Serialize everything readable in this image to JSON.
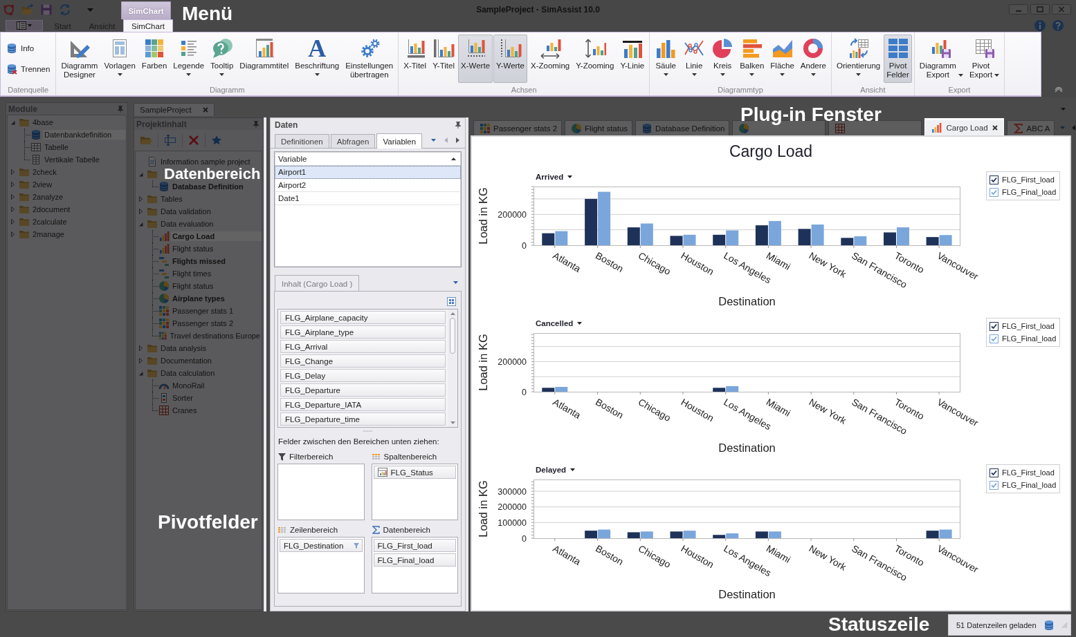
{
  "window": {
    "title": "SampleProject - SimAssist 10.0"
  },
  "context_tab": "SimChart",
  "ribbon_tabs": [
    {
      "label": "Start",
      "selected": false
    },
    {
      "label": "Ansicht",
      "selected": false
    },
    {
      "label": "SimChart",
      "selected": true
    }
  ],
  "ribbon": {
    "groups": [
      {
        "label": "Datenquelle",
        "buttons": [
          {
            "label": "Info",
            "kind": "small",
            "selected": false,
            "dropdown": false
          },
          {
            "label": "Trennen",
            "kind": "small",
            "selected": false,
            "dropdown": false
          }
        ]
      },
      {
        "label": "Diagramm",
        "buttons": [
          {
            "label": "Diagramm\nDesigner",
            "kind": "large",
            "selected": false,
            "dropdown": false
          },
          {
            "label": "Vorlagen",
            "kind": "large",
            "selected": false,
            "dropdown": true
          },
          {
            "label": "Farben",
            "kind": "large",
            "selected": false,
            "dropdown": false
          },
          {
            "label": "Legende",
            "kind": "large",
            "selected": false,
            "dropdown": true
          },
          {
            "label": "Tooltip",
            "kind": "large",
            "selected": false,
            "dropdown": true
          },
          {
            "label": "Diagrammtitel",
            "kind": "large",
            "selected": false,
            "dropdown": false
          },
          {
            "label": "Beschriftung",
            "kind": "large",
            "glyph": "A",
            "selected": false,
            "dropdown": true
          },
          {
            "label": "Einstellungen\nübertragen",
            "kind": "large",
            "selected": false,
            "dropdown": false
          }
        ]
      },
      {
        "label": "Achsen",
        "buttons": [
          {
            "label": "X-Titel",
            "kind": "large",
            "selected": false,
            "dropdown": false
          },
          {
            "label": "Y-Titel",
            "kind": "large",
            "selected": false,
            "dropdown": false
          },
          {
            "label": "X-Werte",
            "kind": "large",
            "selected": true,
            "dropdown": false
          },
          {
            "label": "Y-Werte",
            "kind": "large",
            "selected": true,
            "dropdown": false
          },
          {
            "label": "X-Zooming",
            "kind": "large",
            "selected": false,
            "dropdown": false
          },
          {
            "label": "Y-Zooming",
            "kind": "large",
            "selected": false,
            "dropdown": false
          },
          {
            "label": "Y-Linie",
            "kind": "large",
            "selected": false,
            "dropdown": false
          }
        ]
      },
      {
        "label": "Diagrammtyp",
        "buttons": [
          {
            "label": "Säule",
            "kind": "large",
            "selected": false,
            "dropdown": true
          },
          {
            "label": "Linie",
            "kind": "large",
            "selected": false,
            "dropdown": true
          },
          {
            "label": "Kreis",
            "kind": "large",
            "selected": false,
            "dropdown": true
          },
          {
            "label": "Balken",
            "kind": "large",
            "selected": false,
            "dropdown": true
          },
          {
            "label": "Fläche",
            "kind": "large",
            "selected": false,
            "dropdown": true
          },
          {
            "label": "Andere",
            "kind": "large",
            "selected": false,
            "dropdown": true
          }
        ]
      },
      {
        "label": "Ansicht",
        "buttons": [
          {
            "label": "Orientierung",
            "kind": "large",
            "selected": false,
            "dropdown": true
          },
          {
            "label": "Pivot\nFelder",
            "kind": "large",
            "selected": true,
            "dropdown": false
          }
        ]
      },
      {
        "label": "Export",
        "buttons": [
          {
            "label": "Diagramm\nExport",
            "kind": "large",
            "selected": false,
            "dropdown": true
          },
          {
            "label": "Pivot\nExport",
            "kind": "large",
            "selected": false,
            "dropdown": true
          }
        ]
      }
    ]
  },
  "modules": {
    "title": "Module",
    "tree": [
      {
        "label": "4base",
        "kind": "folder",
        "expanded": true,
        "selected": false,
        "children": [
          {
            "label": "Datenbankdefinition",
            "kind": "database",
            "selected": true
          },
          {
            "label": "Tabelle",
            "kind": "table",
            "selected": false
          },
          {
            "label": "Vertikale Tabelle",
            "kind": "vertical-table",
            "selected": false
          }
        ]
      },
      {
        "label": "2check",
        "kind": "folder",
        "expanded": false,
        "selected": false
      },
      {
        "label": "2view",
        "kind": "folder",
        "expanded": false,
        "selected": false
      },
      {
        "label": "2analyze",
        "kind": "folder",
        "expanded": false,
        "selected": false
      },
      {
        "label": "2document",
        "kind": "folder",
        "expanded": false,
        "selected": false
      },
      {
        "label": "2calculate",
        "kind": "folder",
        "expanded": false,
        "selected": false
      },
      {
        "label": "2manage",
        "kind": "folder",
        "expanded": false,
        "selected": false
      }
    ]
  },
  "project": {
    "tab": "SampleProject",
    "title": "Projektinhalt",
    "tree": [
      {
        "label": "Information sample project",
        "kind": "document",
        "selected": false,
        "bold": false
      },
      {
        "kind": "folder",
        "expanded": true,
        "children": [
          {
            "label": "Database Definition",
            "kind": "database",
            "selected": false,
            "bold": true
          }
        ]
      },
      {
        "label": "Tables",
        "kind": "folder",
        "expanded": false,
        "selected": false,
        "bold": false
      },
      {
        "label": "Data validation",
        "kind": "folder",
        "expanded": false,
        "selected": false,
        "bold": false
      },
      {
        "label": "Data evaluation",
        "kind": "folder",
        "expanded": true,
        "selected": false,
        "bold": false,
        "children": [
          {
            "label": "Cargo Load",
            "kind": "bar-chart",
            "selected": true,
            "bold": true
          },
          {
            "label": "Flight status",
            "kind": "bar-chart",
            "selected": false,
            "bold": false
          },
          {
            "label": "Flights missed",
            "kind": "gantt-chart",
            "selected": false,
            "bold": true
          },
          {
            "label": "Flight times",
            "kind": "gantt-chart",
            "selected": false,
            "bold": false
          },
          {
            "label": "Flight status",
            "kind": "pie-chart",
            "selected": false,
            "bold": false
          },
          {
            "label": "Airplane types",
            "kind": "pie-chart",
            "selected": false,
            "bold": true
          },
          {
            "label": "Passenger stats 1",
            "kind": "heatmap",
            "selected": false,
            "bold": false
          },
          {
            "label": "Passenger stats 2",
            "kind": "heatmap",
            "selected": false,
            "bold": false
          },
          {
            "label": "Travel destinations Europe",
            "kind": "heatmap",
            "selected": false,
            "bold": false
          }
        ]
      },
      {
        "label": "Data analysis",
        "kind": "folder",
        "expanded": false,
        "selected": false,
        "bold": false
      },
      {
        "label": "Documentation",
        "kind": "folder",
        "expanded": false,
        "selected": false,
        "bold": false
      },
      {
        "label": "Data calculation",
        "kind": "folder",
        "expanded": true,
        "selected": false,
        "bold": false,
        "children": [
          {
            "label": "MonoRail",
            "kind": "gauge",
            "selected": false,
            "bold": false
          },
          {
            "label": "Sorter",
            "kind": "sorter",
            "selected": false,
            "bold": false
          },
          {
            "label": "Cranes",
            "kind": "crane",
            "selected": false,
            "bold": false
          }
        ]
      }
    ]
  },
  "data_panel": {
    "title": "Daten",
    "tabs": [
      {
        "label": "Definitionen",
        "selected": false
      },
      {
        "label": "Abfragen",
        "selected": false
      },
      {
        "label": "Variablen",
        "selected": true
      }
    ],
    "variables": {
      "column": "Variable",
      "sort_ascending": true,
      "rows": [
        {
          "label": "Airport1",
          "selected": true
        },
        {
          "label": "Airport2",
          "selected": false
        },
        {
          "label": "Date1",
          "selected": false
        }
      ]
    },
    "content_tab": "Inhalt (Cargo Load )",
    "fields": [
      "FLG_Airplane_capacity",
      "FLG_Airplane_type",
      "FLG_Arrival",
      "FLG_Change",
      "FLG_Delay",
      "FLG_Departure",
      "FLG_Departure_IATA",
      "FLG_Departure_time"
    ],
    "hint": "Felder zwischen den Bereichen unten ziehen:",
    "areas": [
      {
        "label": "Filterbereich",
        "kind": "filter"
      },
      {
        "label": "Spaltenbereich",
        "kind": "columns",
        "fields": [
          {
            "label": "FLG_Status"
          }
        ]
      },
      {
        "label": "Zeilenbereich",
        "kind": "rows",
        "fields": [
          {
            "label": "FLG_Destination"
          }
        ]
      },
      {
        "label": "Datenbereich",
        "kind": "data",
        "fields": [
          {
            "label": "FLG_First_load"
          },
          {
            "label": "FLG_Final_load"
          }
        ]
      }
    ]
  },
  "plugin_tabs": [
    {
      "label": "Passenger stats 2",
      "kind": "heatmap",
      "selected": false
    },
    {
      "label": "Flight status",
      "kind": "pie-chart",
      "selected": false
    },
    {
      "label": "Database Definition",
      "kind": "database",
      "selected": false
    },
    {
      "kind": "pie-chart",
      "selected": false
    },
    {
      "kind": "crane",
      "selected": false
    },
    {
      "label": "Cargo Load",
      "kind": "bar-chart",
      "selected": true
    },
    {
      "label": "ABC A",
      "kind": "sum",
      "selected": false
    }
  ],
  "chart_title": "Cargo Load",
  "charts": [
    {
      "filter": "Arrived",
      "legend": [
        {
          "checked": true
        },
        {
          "checked": true
        }
      ],
      "chart_data": {
        "type": "bar",
        "xlabel": "Destination",
        "ylabel": "Load in KG",
        "categories": [
          "Atlanta",
          "Boston",
          "Chicago",
          "Houston",
          "Los Angeles",
          "Miami",
          "New York",
          "San Francisco",
          "Toronto",
          "Vancouver"
        ],
        "series": [
          {
            "name": "FLG_First_load",
            "color": "#1e3259",
            "values": [
              78000,
              300000,
              116000,
              61000,
              68000,
              129000,
              106000,
              48000,
              83000,
              53000
            ]
          },
          {
            "name": "FLG_Final_load",
            "color": "#7aa6db",
            "values": [
              91000,
              346000,
              141000,
              68000,
              96000,
              157000,
              134000,
              58000,
              116000,
              66000
            ]
          }
        ],
        "ylim": [
          0,
          380000
        ],
        "yticks": [
          0,
          200000
        ],
        "grid": true
      }
    },
    {
      "filter": "Cancelled",
      "legend": [
        {
          "checked": true
        },
        {
          "checked": true
        }
      ],
      "chart_data": {
        "type": "bar",
        "xlabel": "Destination",
        "ylabel": "Load in KG",
        "categories": [
          "Atlanta",
          "Boston",
          "Chicago",
          "Houston",
          "Los Angeles",
          "Miami",
          "New York",
          "San Francisco",
          "Toronto",
          "Vancouver"
        ],
        "series": [
          {
            "name": "FLG_First_load",
            "color": "#1e3259",
            "values": [
              26000,
              0,
              0,
              0,
              26000,
              0,
              0,
              0,
              0,
              0
            ]
          },
          {
            "name": "FLG_Final_load",
            "color": "#7aa6db",
            "values": [
              32000,
              0,
              0,
              0,
              37000,
              0,
              0,
              0,
              0,
              0
            ]
          }
        ],
        "ylim": [
          0,
          390000
        ],
        "yticks": [
          0,
          200000
        ],
        "grid": true
      }
    },
    {
      "filter": "Delayed",
      "legend": [
        {
          "checked": true
        },
        {
          "checked": true
        }
      ],
      "chart_data": {
        "type": "bar",
        "xlabel": "Destination",
        "ylabel": "Load in KG",
        "categories": [
          "Atlanta",
          "Boston",
          "Chicago",
          "Houston",
          "Los Angeles",
          "Miami",
          "New York",
          "San Francisco",
          "Toronto",
          "Vancouver"
        ],
        "series": [
          {
            "name": "FLG_First_load",
            "color": "#1e3259",
            "values": [
              0,
              48000,
              38000,
              43000,
              21000,
              43000,
              0,
              0,
              0,
              48000
            ]
          },
          {
            "name": "FLG_Final_load",
            "color": "#7aa6db",
            "values": [
              0,
              55000,
              43000,
              48000,
              31000,
              43000,
              0,
              0,
              0,
              55000
            ]
          }
        ],
        "ylim": [
          0,
          375000
        ],
        "yticks": [
          0,
          100000,
          200000,
          300000
        ],
        "grid": true
      }
    }
  ],
  "status": {
    "text": "51 Datenzeilen geladen"
  },
  "annotations": [
    "Menü",
    "Datenbereich",
    "Plug-in Fenster",
    "Pivotfelder",
    "Statuszeile"
  ]
}
